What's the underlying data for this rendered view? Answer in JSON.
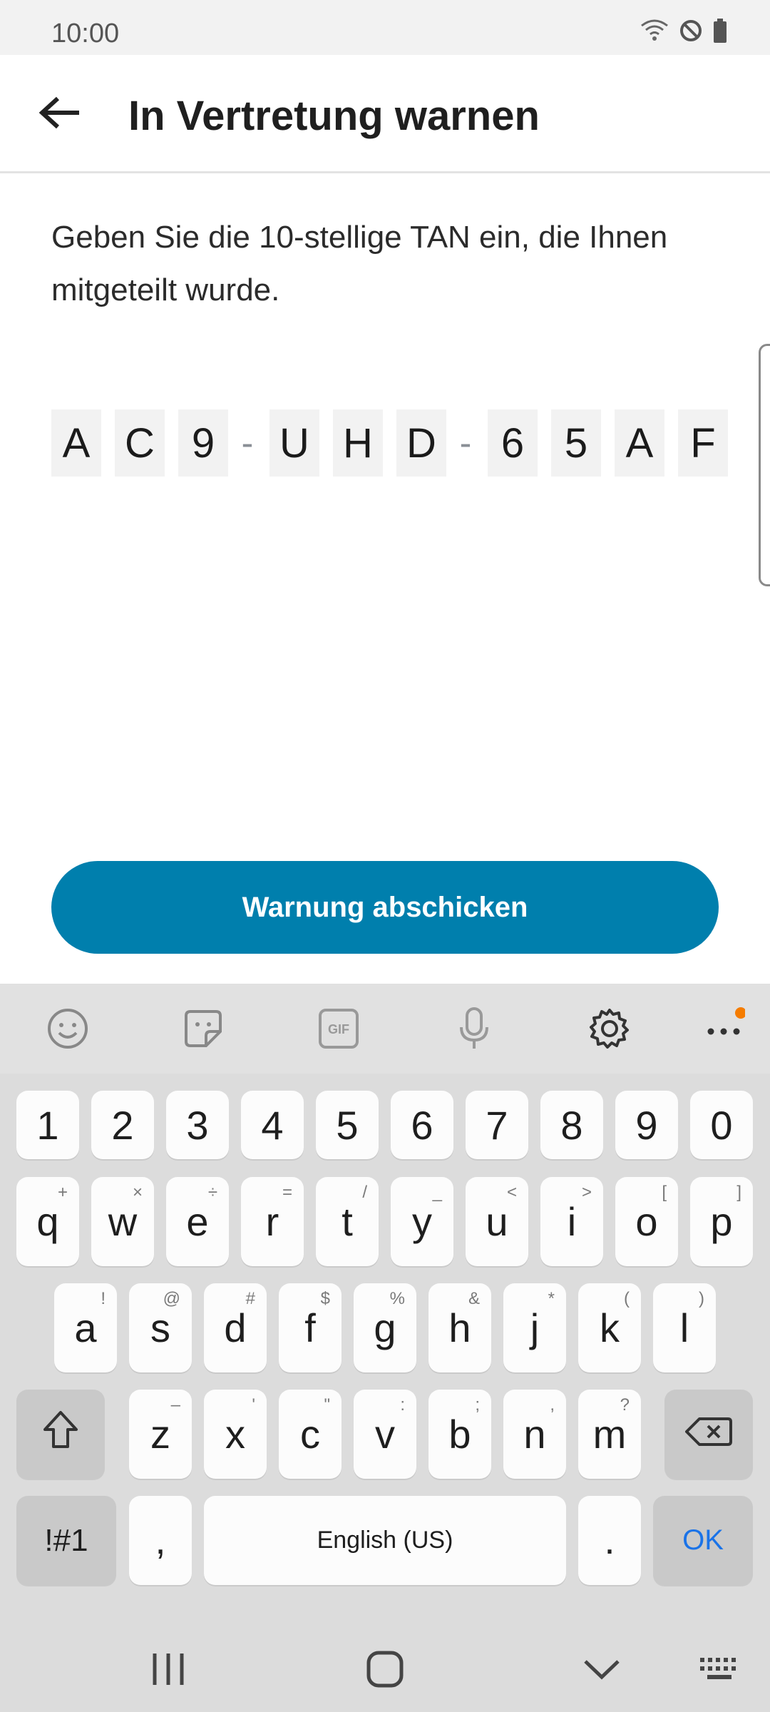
{
  "status_bar": {
    "time": "10:00"
  },
  "app_bar": {
    "title": "In Vertretung warnen"
  },
  "instruction": "Geben Sie die 10-stellige TAN ein, die Ihnen mitgeteilt wurde.",
  "tan": {
    "chars": [
      "A",
      "C",
      "9",
      "U",
      "H",
      "D",
      "6",
      "5",
      "A",
      "F"
    ],
    "separator": "-"
  },
  "submit_button": {
    "label": "Warnung abschicken"
  },
  "keyboard": {
    "row_numbers": [
      "1",
      "2",
      "3",
      "4",
      "5",
      "6",
      "7",
      "8",
      "9",
      "0"
    ],
    "row_q": [
      [
        "q",
        "+"
      ],
      [
        "w",
        "×"
      ],
      [
        "e",
        "÷"
      ],
      [
        "r",
        "="
      ],
      [
        "t",
        "/"
      ],
      [
        "y",
        "_"
      ],
      [
        "u",
        "<"
      ],
      [
        "i",
        ">"
      ],
      [
        "o",
        "["
      ],
      [
        "p",
        "]"
      ]
    ],
    "row_a": [
      [
        "a",
        "!"
      ],
      [
        "s",
        "@"
      ],
      [
        "d",
        "#"
      ],
      [
        "f",
        "$"
      ],
      [
        "g",
        "%"
      ],
      [
        "h",
        "&"
      ],
      [
        "j",
        "*"
      ],
      [
        "k",
        "("
      ],
      [
        "l",
        ")"
      ]
    ],
    "row_z": [
      [
        "z",
        "–"
      ],
      [
        "x",
        "'"
      ],
      [
        "c",
        "\""
      ],
      [
        "v",
        ":"
      ],
      [
        "b",
        ";"
      ],
      [
        "n",
        ","
      ],
      [
        "m",
        "?"
      ]
    ],
    "symbols_label": "!#1",
    "comma": ",",
    "space_label": "English (US)",
    "period": ".",
    "ok_label": "OK",
    "accent_color": "#1a73e8",
    "notification_dot_color": "#f57c00"
  },
  "colors": {
    "primary_button": "#007fad"
  }
}
